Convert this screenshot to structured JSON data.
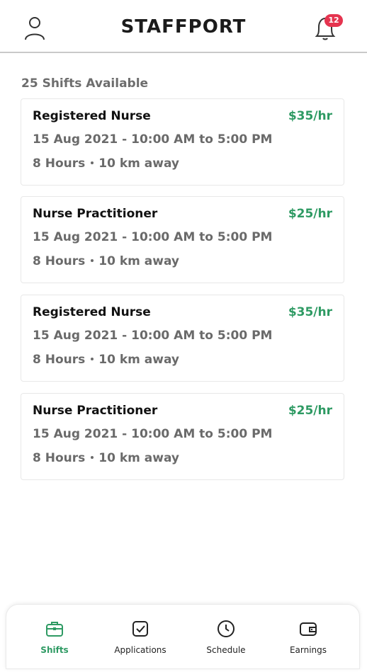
{
  "app": {
    "brand": "STAFFPORT",
    "notification_count": "12"
  },
  "shifts": {
    "count_text": "25 Shifts Available",
    "items": [
      {
        "title": "Registered Nurse",
        "rate": "$35/hr",
        "when": "15 Aug 2021 - 10:00 AM to 5:00 PM",
        "hours": "8 Hours",
        "distance": "10 km away"
      },
      {
        "title": "Nurse Practitioner",
        "rate": "$25/hr",
        "when": "15 Aug 2021 - 10:00 AM to 5:00 PM",
        "hours": "8 Hours",
        "distance": "10 km away"
      },
      {
        "title": "Registered Nurse",
        "rate": "$35/hr",
        "when": "15 Aug 2021 - 10:00 AM to 5:00 PM",
        "hours": "8 Hours",
        "distance": "10 km away"
      },
      {
        "title": "Nurse Practitioner",
        "rate": "$25/hr",
        "when": "15 Aug 2021 - 10:00 AM to 5:00 PM",
        "hours": "8 Hours",
        "distance": "10 km away"
      }
    ]
  },
  "nav": {
    "items": [
      {
        "label": "Shifts",
        "icon": "briefcase-icon",
        "active": true
      },
      {
        "label": "Applications",
        "icon": "check-square-icon",
        "active": false
      },
      {
        "label": "Schedule",
        "icon": "clock-icon",
        "active": false
      },
      {
        "label": "Earnings",
        "icon": "wallet-icon",
        "active": false
      }
    ]
  },
  "colors": {
    "accent": "#2e9a63",
    "badge": "#e5344f",
    "muted": "#6a6a6a"
  }
}
